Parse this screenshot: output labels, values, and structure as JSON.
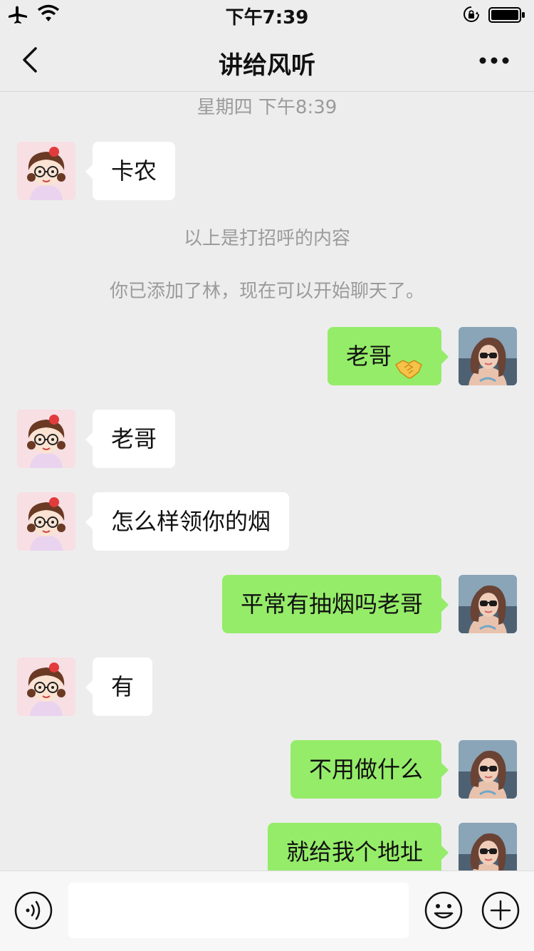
{
  "status_bar": {
    "time": "下午7:39"
  },
  "header": {
    "title": "讲给风听"
  },
  "chat": {
    "timestamp": "星期四 下午8:39",
    "notes": [
      "以上是打招呼的内容",
      "你已添加了林，现在可以开始聊天了。"
    ],
    "messages": [
      {
        "side": "in",
        "text": "卡农"
      },
      {
        "side": "out",
        "text": "老哥",
        "emoji": "handshake-emoji"
      },
      {
        "side": "in",
        "text": "老哥"
      },
      {
        "side": "in",
        "text": "怎么样领你的烟"
      },
      {
        "side": "out",
        "text": "平常有抽烟吗老哥"
      },
      {
        "side": "in",
        "text": "有"
      },
      {
        "side": "out",
        "text": "不用做什么"
      },
      {
        "side": "out",
        "text": "就给我个地址"
      }
    ]
  },
  "input_bar": {
    "value": "",
    "placeholder": ""
  },
  "icons": [
    "airplane-icon",
    "wifi-icon",
    "orientation-lock-icon",
    "battery-icon",
    "back-chevron-icon",
    "more-icon",
    "voice-icon",
    "emoji-icon",
    "plus-icon"
  ],
  "colors": {
    "background": "#ededed",
    "outgoing_bubble": "#95ec69",
    "incoming_bubble": "#ffffff",
    "meta_text": "#9b9b9b"
  }
}
